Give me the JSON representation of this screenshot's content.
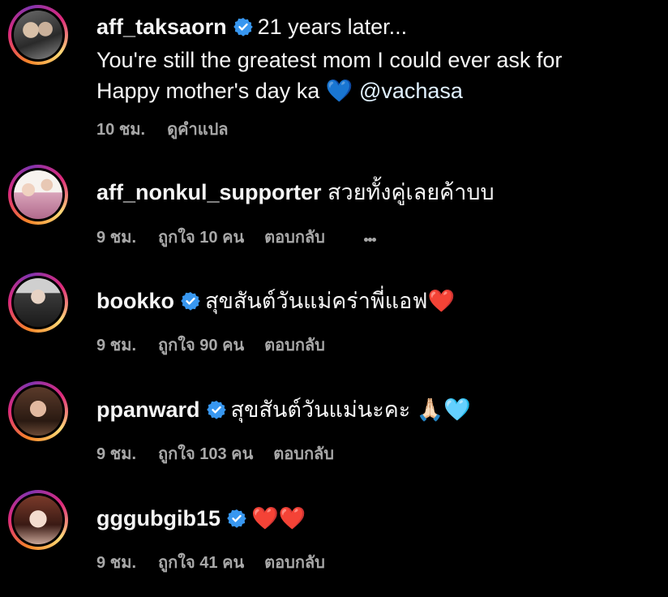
{
  "colors": {
    "background": "#000000",
    "text": "#f5f5f5",
    "meta": "#a8a8a8",
    "verified": "#3897f0"
  },
  "comments": [
    {
      "username": "aff_taksaorn",
      "verified": true,
      "text_line1": "21 years later...",
      "text_line2": "You're still the greatest mom I could ever ask for",
      "text_line3_prefix": "Happy mother's day ka",
      "text_line3_emoji": "💙",
      "mention": "@vachasa",
      "time": "10 ชม.",
      "action": "ดูคำแปล"
    },
    {
      "username": "aff_nonkul_supporter",
      "verified": false,
      "text": "สวยทั้งคู่เลยค้าบบ",
      "time": "9 ชม.",
      "likes": "ถูกใจ 10 คน",
      "reply": "ตอบกลับ",
      "more_icon": "more-horizontal-icon"
    },
    {
      "username": "bookko",
      "verified": true,
      "text": "สุขสันต์วันแม่คร่าพี่แอฟ❤️",
      "time": "9 ชม.",
      "likes": "ถูกใจ 90 คน",
      "reply": "ตอบกลับ"
    },
    {
      "username": "ppanward",
      "verified": true,
      "text": "สุขสันต์วันแม่นะคะ 🙏🏻🩵",
      "time": "9 ชม.",
      "likes": "ถูกใจ 103 คน",
      "reply": "ตอบกลับ"
    },
    {
      "username": "gggubgib15",
      "verified": true,
      "text": "❤️❤️",
      "time": "9 ชม.",
      "likes": "ถูกใจ 41 คน",
      "reply": "ตอบกลับ"
    }
  ]
}
